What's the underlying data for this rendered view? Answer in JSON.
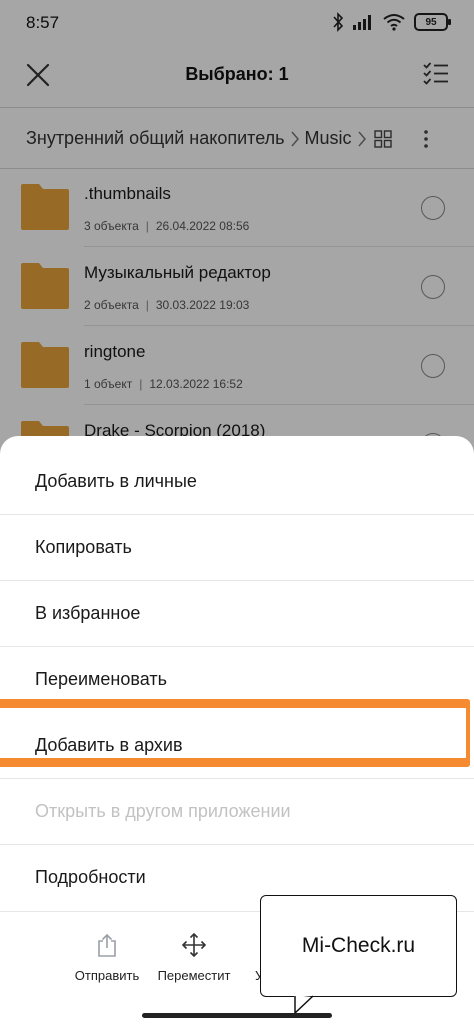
{
  "status_bar": {
    "time": "8:57",
    "battery": "95"
  },
  "app_bar": {
    "title": "Выбрано: 1"
  },
  "breadcrumb": {
    "items": [
      "Знутренний общий накопитель",
      "Music"
    ]
  },
  "files": [
    {
      "name": ".thumbnails",
      "count": "3 объекта",
      "date": "26.04.2022 08:56"
    },
    {
      "name": "Музыкальный редактор",
      "count": "2 объекта",
      "date": "30.03.2022 19:03"
    },
    {
      "name": "ringtone",
      "count": "1 объект",
      "date": "12.03.2022 16:52"
    },
    {
      "name": "Drake - Scorpion (2018)",
      "count": "",
      "date": ""
    }
  ],
  "menu": {
    "items": [
      {
        "label": "Добавить в личные",
        "enabled": true
      },
      {
        "label": "Копировать",
        "enabled": true
      },
      {
        "label": "В избранное",
        "enabled": true
      },
      {
        "label": "Переименовать",
        "enabled": true
      },
      {
        "label": "Добавить в архив",
        "enabled": true,
        "highlighted": true
      },
      {
        "label": "Открыть в другом приложении",
        "enabled": false
      },
      {
        "label": "Подробности",
        "enabled": true
      }
    ]
  },
  "actions": [
    {
      "label": "Отправить",
      "icon": "share-icon"
    },
    {
      "label": "Переместит",
      "icon": "move-icon"
    },
    {
      "label": "У",
      "icon": "delete-icon"
    }
  ],
  "watermark": {
    "text": "Mi-Check.ru"
  },
  "colors": {
    "folder": "#e8a53a",
    "highlight": "#f58a30",
    "disabled_text": "#c2c2c2"
  }
}
